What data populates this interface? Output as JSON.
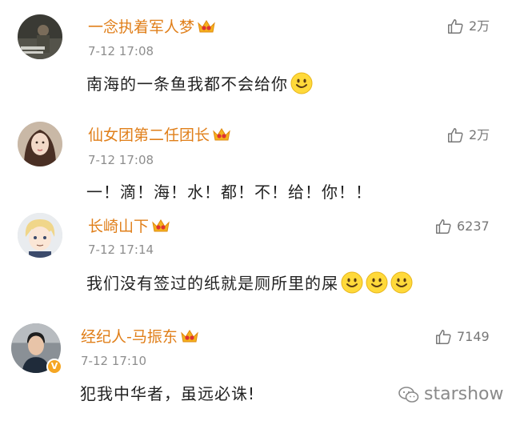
{
  "comments": [
    {
      "username": "一念执着军人梦",
      "time": "7-12 17:08",
      "text": "南海的一条鱼我都不会给你",
      "likes": "2万",
      "emoji_count": 1,
      "avatar_icon": "soldier-photo-avatar"
    },
    {
      "username": "仙女团第二任团长",
      "time": "7-12 17:08",
      "text": "一！滴！海！水！都！不！给！你！！",
      "likes": "2万",
      "emoji_count": 0,
      "avatar_icon": "girl-photo-avatar"
    },
    {
      "username": "长崎山下",
      "time": "7-12 17:14",
      "text": "我们没有签过的纸就是厕所里的屎",
      "likes": "6237",
      "emoji_count": 3,
      "avatar_icon": "anime-boy-avatar"
    },
    {
      "username": "经纪人-马振东",
      "time": "7-12 17:10",
      "text": "犯我中华者，虽远必诛!",
      "likes": "7149",
      "emoji_count": 0,
      "avatar_icon": "man-photo-avatar"
    }
  ],
  "watermark": {
    "text": "starshow"
  },
  "colors": {
    "username": "#e07f1a",
    "time": "#8e8e8e",
    "text": "#222222",
    "like": "#777777"
  }
}
